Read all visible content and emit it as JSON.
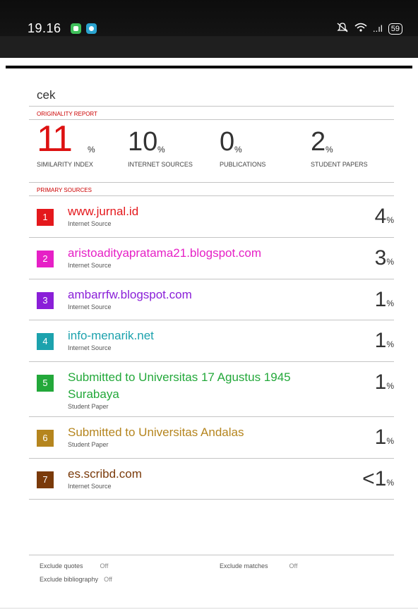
{
  "statusbar": {
    "time": "19.16",
    "battery": "59",
    "signal_glyph": "..ıl"
  },
  "document_title": "cek",
  "originality_report_label": "ORIGINALITY REPORT",
  "stats": {
    "similarity": {
      "value": "11",
      "unit": "%",
      "label": "SIMILARITY INDEX"
    },
    "internet": {
      "value": "10",
      "unit": "%",
      "label": "INTERNET SOURCES"
    },
    "publications": {
      "value": "0",
      "unit": "%",
      "label": "PUBLICATIONS"
    },
    "student": {
      "value": "2",
      "unit": "%",
      "label": "STUDENT PAPERS"
    }
  },
  "primary_sources_label": "PRIMARY SOURCES",
  "sources": [
    {
      "num": "1",
      "name": "www.jurnal.id",
      "type": "Internet Source",
      "pct": "4",
      "color": "#e4181c"
    },
    {
      "num": "2",
      "name": "aristoadityapratama21.blogspot.com",
      "type": "Internet Source",
      "pct": "3",
      "color": "#e620c6"
    },
    {
      "num": "3",
      "name": "ambarrfw.blogspot.com",
      "type": "Internet Source",
      "pct": "1",
      "color": "#8a1fd8"
    },
    {
      "num": "4",
      "name": "info-menarik.net",
      "type": "Internet Source",
      "pct": "1",
      "color": "#1ca2ad"
    },
    {
      "num": "5",
      "name": "Submitted to Universitas 17 Agustus 1945 Surabaya",
      "type": "Student Paper",
      "pct": "1",
      "color": "#23a83a"
    },
    {
      "num": "6",
      "name": "Submitted to Universitas Andalas",
      "type": "Student Paper",
      "pct": "1",
      "color": "#b5851e"
    },
    {
      "num": "7",
      "name": "es.scribd.com",
      "type": "Internet Source",
      "pct": "<1",
      "color": "#7a3a0a"
    }
  ],
  "pct_unit": "%",
  "exclusions": {
    "quotes_label": "Exclude quotes",
    "quotes_value": "Off",
    "bibliography_label": "Exclude bibliography",
    "bibliography_value": "Off",
    "matches_label": "Exclude matches",
    "matches_value": "Off"
  }
}
